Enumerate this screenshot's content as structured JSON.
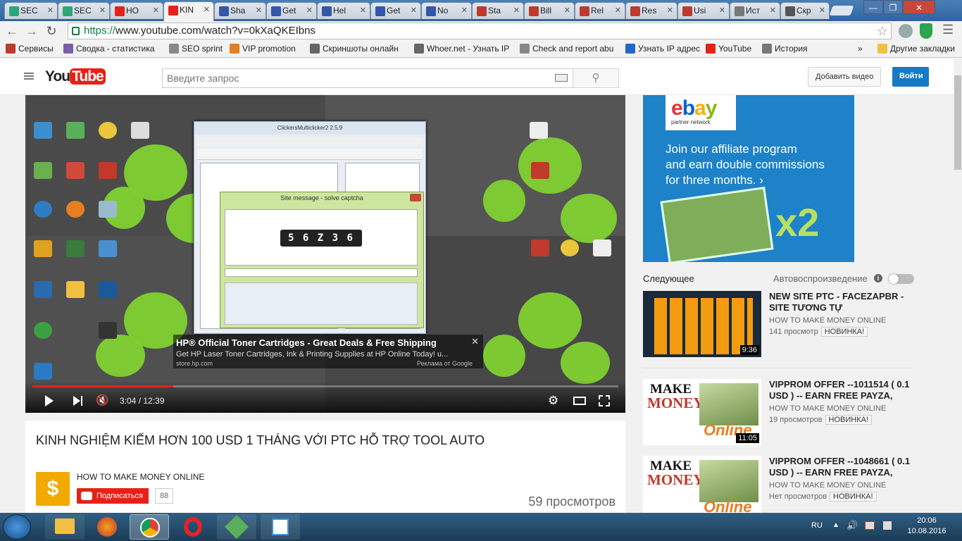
{
  "browser": {
    "tabs": [
      {
        "label": "SEC",
        "fav_color": "#2aa876"
      },
      {
        "label": "SEC",
        "fav_color": "#2aa876"
      },
      {
        "label": "HO",
        "fav_color": "#e62117"
      },
      {
        "label": "KIN",
        "fav_color": "#e62117",
        "active": true
      },
      {
        "label": "Sha",
        "fav_color": "#3355aa"
      },
      {
        "label": "Get",
        "fav_color": "#3355aa"
      },
      {
        "label": "Hel",
        "fav_color": "#3355aa"
      },
      {
        "label": "Get",
        "fav_color": "#3355aa"
      },
      {
        "label": "No",
        "fav_color": "#3355aa"
      },
      {
        "label": "Sta",
        "fav_color": "#c0392b"
      },
      {
        "label": "Bill",
        "fav_color": "#c0392b"
      },
      {
        "label": "Rel",
        "fav_color": "#c0392b"
      },
      {
        "label": "Res",
        "fav_color": "#c0392b"
      },
      {
        "label": "Usi",
        "fav_color": "#c0392b"
      },
      {
        "label": "Ист",
        "fav_color": "#777777"
      },
      {
        "label": "Скр",
        "fav_color": "#555555"
      }
    ],
    "url_prefix": "https://",
    "url_rest": "www.youtube.com/watch?v=0kXaQKEIbns",
    "bookmarks": [
      {
        "label": "Сервисы",
        "color": "#c0392b"
      },
      {
        "label": "Сводка - статистика",
        "color": "#7b5ea7"
      },
      {
        "label": "SEO sprint",
        "color": "#888888"
      },
      {
        "label": "VIP promotion",
        "color": "#e67e22"
      },
      {
        "label": "Скриншоты онлайн",
        "color": "#666666"
      },
      {
        "label": "Whoer.net - Узнать IP",
        "color": "#666666"
      },
      {
        "label": "Check and report abu",
        "color": "#888888"
      },
      {
        "label": "Узнать IP адрес",
        "color": "#2266cc"
      },
      {
        "label": "YouTube",
        "color": "#e62117"
      },
      {
        "label": "История",
        "color": "#777777"
      }
    ],
    "bookmarks_more": "»",
    "other_bookmarks": "Другие закладки"
  },
  "youtube": {
    "logo_you": "You",
    "logo_tube": "Tube",
    "search_placeholder": "Введите запрос",
    "upload_label": "Добавить видео",
    "signin_label": "Войти"
  },
  "video": {
    "app_title": "ClickersMulticlicker2 2.5.9",
    "captcha_title": "Site message - solve captcha",
    "captcha_text": "5 6 Z 3 6",
    "ad_title": "HP® Official Toner Cartridges - Great Deals & Free Shipping",
    "ad_text": "Get HP Laser Toner Cartridges, Ink & Printing Supplies at HP Online Today! u...",
    "ad_url": "store.hp.com",
    "ad_credit": "Реклама от Google",
    "time_current": "3:04",
    "time_total": "12:39",
    "progress": 0.24
  },
  "info": {
    "title": "KINH NGHIỆM KIẾM HƠN 100 USD 1 THÁNG VỚI PTC HỖ TRỢ TOOL AUTO",
    "channel": "HOW TO MAKE MONEY ONLINE",
    "subscribe": "Подписаться",
    "subscribers": "88",
    "views": "59 просмотров"
  },
  "sidebar": {
    "ad_brand": "ebay",
    "ad_network": "partner network",
    "ad_line1": "Join our affiliate program",
    "ad_line2": "and earn double commissions",
    "ad_line3": "for three months.",
    "ad_multiplier": "x2",
    "next_label": "Следующее",
    "autoplay_label": "Автовоспроизведение",
    "recs": [
      {
        "title": "NEW SITE PTC - FACEZAPBR - SITE TƯƠNG TỰ",
        "channel": "HOW TO MAKE MONEY ONLINE",
        "views": "141 просмотр",
        "badge": "НОВИНКА!",
        "duration": "9:36"
      },
      {
        "title": "VIPPROM OFFER --1011514 ( 0.1 USD ) -- EARN FREE PAYZA,",
        "channel": "HOW TO MAKE MONEY ONLINE",
        "views": "19 просмотров",
        "badge": "НОВИНКА!",
        "duration": "11:05"
      },
      {
        "title": "VIPPROM OFFER --1048661 ( 0.1 USD ) -- EARN FREE PAYZA,",
        "channel": "HOW TO MAKE MONEY ONLINE",
        "views": "Нет просмотров",
        "badge": "НОВИНКА!",
        "duration": ""
      }
    ],
    "thumb_text_make": "MAKE",
    "thumb_text_money": "MONEY",
    "thumb_text_online": "Online"
  },
  "taskbar": {
    "lang": "RU",
    "time": "20:06",
    "date": "10.08.2016"
  }
}
